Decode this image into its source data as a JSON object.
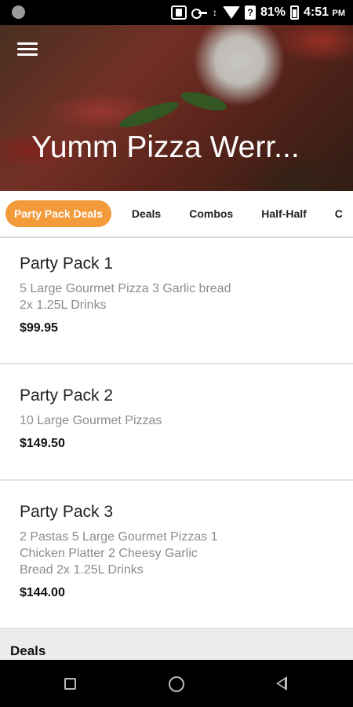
{
  "status_bar": {
    "battery": "81%",
    "time": "4:51",
    "ampm": "PM",
    "icons": [
      "notification-dot-icon",
      "vibrate-icon",
      "vpn-key-icon",
      "data-arrows-icon",
      "wifi-icon",
      "signal-icon",
      "battery-icon"
    ]
  },
  "header": {
    "title": "Yumm Pizza Werr...",
    "menu_icon": "hamburger-menu-icon"
  },
  "tabs": [
    {
      "label": "Party Pack Deals",
      "active": true
    },
    {
      "label": "Deals",
      "active": false
    },
    {
      "label": "Combos",
      "active": false
    },
    {
      "label": "Half-Half",
      "active": false
    },
    {
      "label": "C",
      "active": false
    }
  ],
  "items": [
    {
      "name": "Party Pack 1",
      "description": "5 Large Gourmet Pizza 3 Garlic bread 2x 1.25L Drinks",
      "price": "$99.95"
    },
    {
      "name": "Party Pack 2",
      "description": "10 Large Gourmet Pizzas",
      "price": "$149.50"
    },
    {
      "name": "Party Pack 3",
      "description": "2 Pastas 5 Large Gourmet Pizzas 1 Chicken Platter 2 Cheesy Garlic Bread 2x 1.25L Drinks",
      "price": "$144.00"
    }
  ],
  "section": {
    "title": "Deals"
  },
  "colors": {
    "accent": "#f39a3a"
  },
  "nav": {
    "icons": [
      "recents-square-icon",
      "home-circle-icon",
      "back-triangle-icon"
    ]
  }
}
